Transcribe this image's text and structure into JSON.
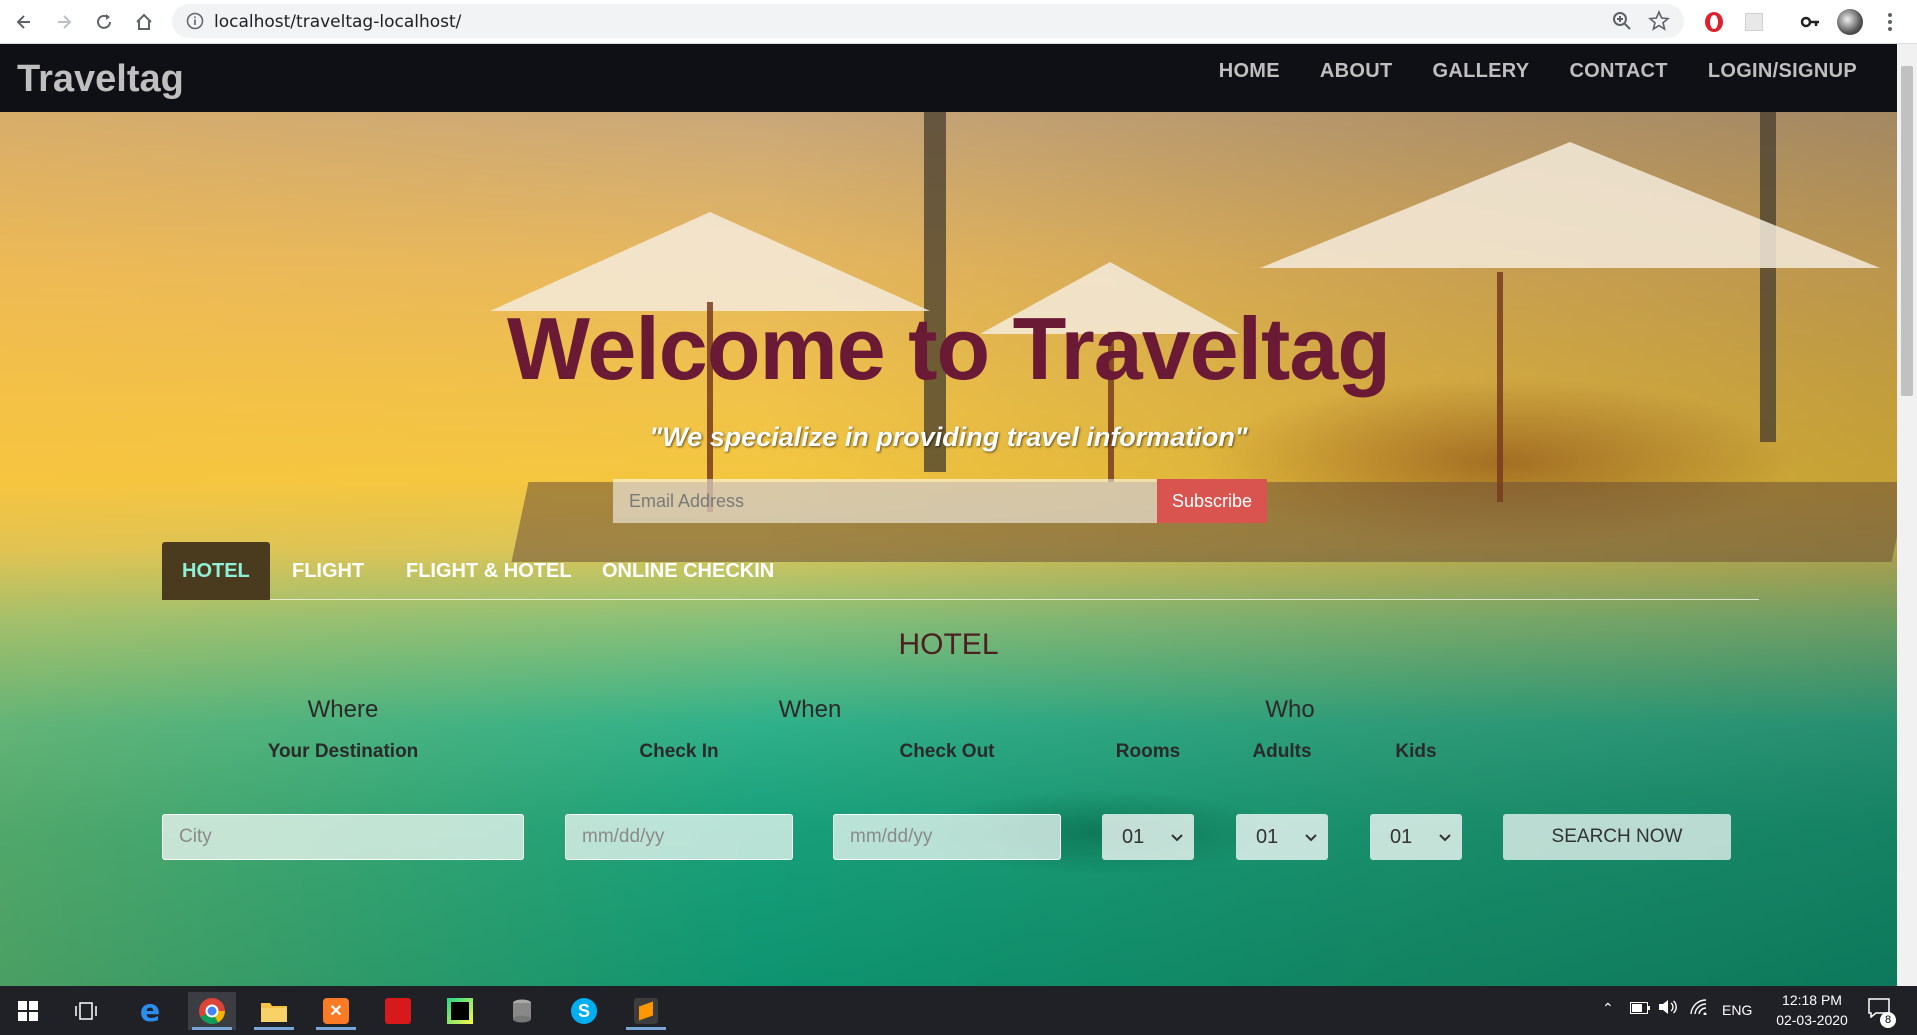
{
  "browser": {
    "url": "localhost/traveltag-localhost/"
  },
  "site": {
    "brand": "Traveltag",
    "menu": [
      "HOME",
      "ABOUT",
      "GALLERY",
      "CONTACT",
      "LOGIN/SIGNUP"
    ]
  },
  "hero": {
    "title": "Welcome to Traveltag",
    "tagline": "\"We specialize in providing travel information\"",
    "email_placeholder": "Email Address",
    "subscribe_label": "Subscribe"
  },
  "tabs": [
    {
      "label": "HOTEL",
      "active": true
    },
    {
      "label": "FLIGHT",
      "active": false
    },
    {
      "label": "FLIGHT & HOTEL",
      "active": false
    },
    {
      "label": "ONLINE CHECKIN",
      "active": false
    }
  ],
  "form": {
    "title": "HOTEL",
    "groups": {
      "where": "Where",
      "when": "When",
      "who": "Who"
    },
    "labels": {
      "destination": "Your Destination",
      "check_in": "Check In",
      "check_out": "Check Out",
      "rooms": "Rooms",
      "adults": "Adults",
      "kids": "Kids"
    },
    "placeholders": {
      "city": "City",
      "check_in": "mm/dd/yy",
      "check_out": "mm/dd/yy"
    },
    "selects": {
      "rooms": "01",
      "adults": "01",
      "kids": "01"
    },
    "search_label": "SEARCH NOW"
  },
  "taskbar": {
    "language": "ENG",
    "time": "12:18 PM",
    "date": "02-03-2020",
    "notifications": "8"
  },
  "colors": {
    "nav_bg": "#0f0f16",
    "title": "#6b1a36",
    "subscribe": "#d9534f",
    "active_tab_text": "#8ff0d8"
  }
}
